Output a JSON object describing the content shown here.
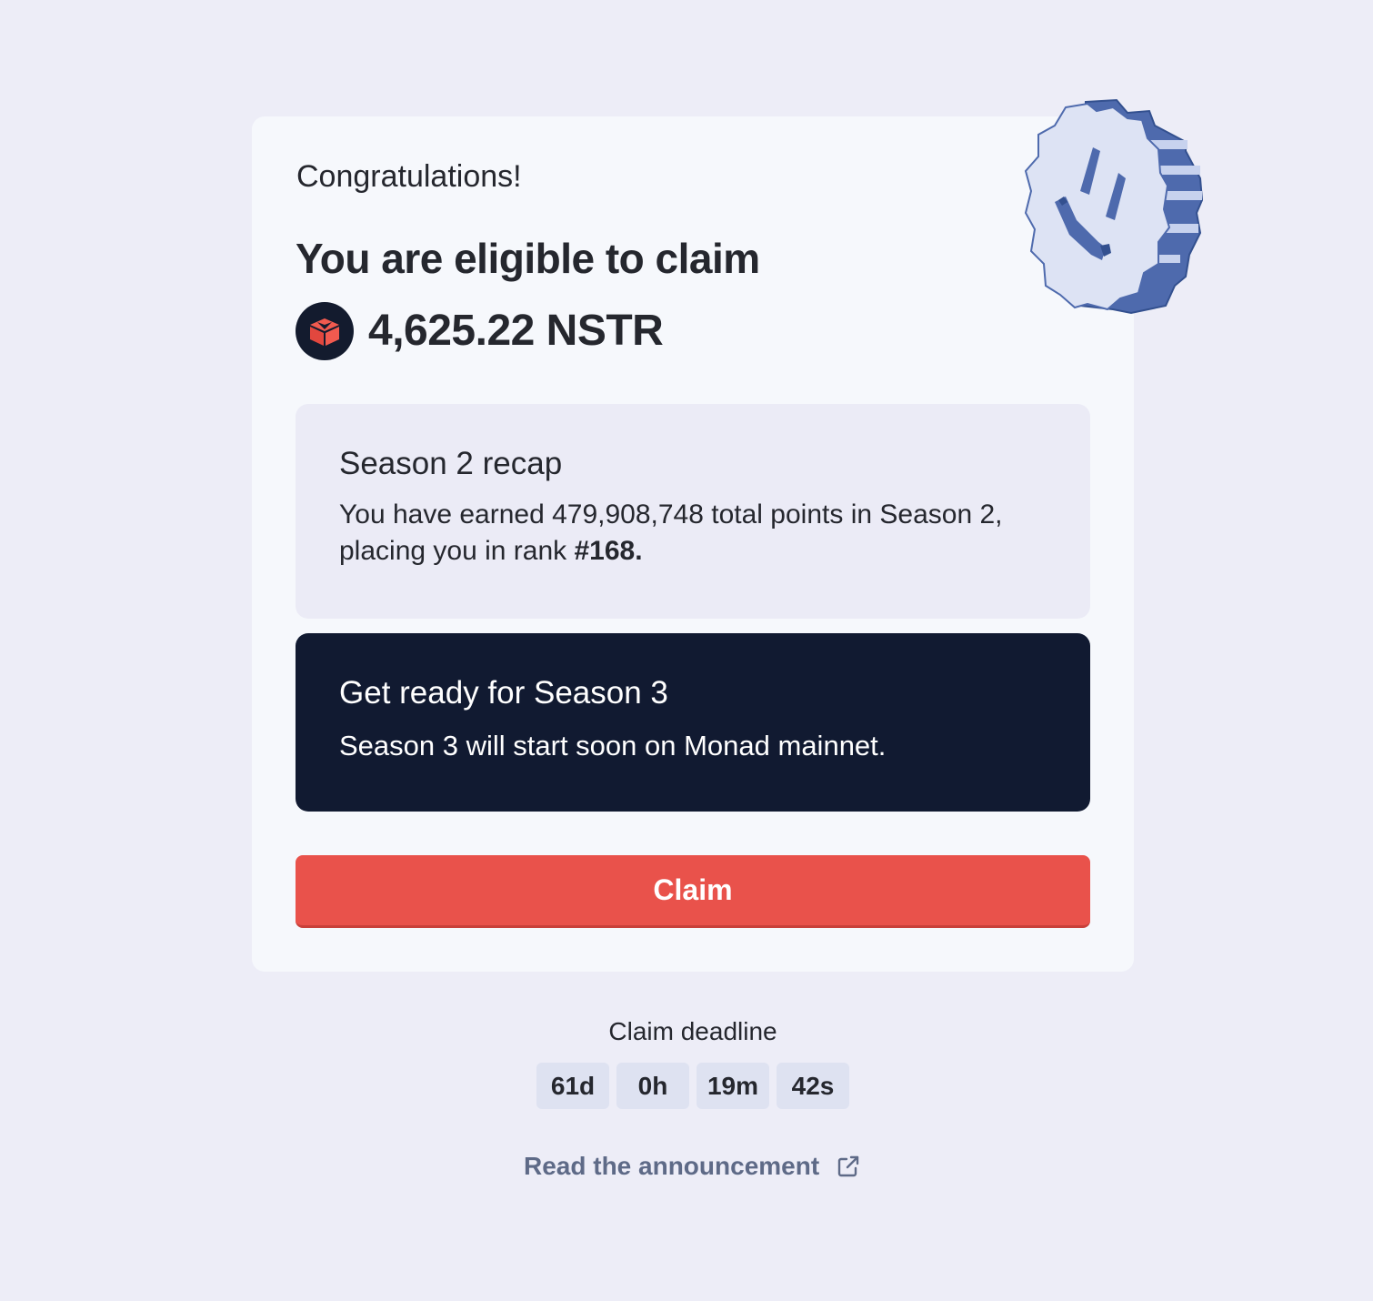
{
  "card": {
    "greeting": "Congratulations!",
    "headline": "You are eligible to claim",
    "amount": "4,625.22 NSTR",
    "token_icon": "nstr-token-icon",
    "mascot_icon": "smiley-coin-icon"
  },
  "recap": {
    "title": "Season 2 recap",
    "body_prefix": "You have earned 479,908,748 total points in Season 2, placing you in rank ",
    "rank": "#168."
  },
  "season3": {
    "title": "Get ready for Season 3",
    "body": "Season 3 will start soon on Monad mainnet."
  },
  "claim_button": {
    "label": "Claim"
  },
  "deadline": {
    "label": "Claim deadline",
    "days": "61d",
    "hours": "0h",
    "minutes": "19m",
    "seconds": "42s"
  },
  "announcement": {
    "label": "Read the announcement",
    "icon": "external-link-icon"
  },
  "colors": {
    "page_bg": "#ededf7",
    "card_bg": "#f6f8fc",
    "recap_bg": "#ebebf6",
    "season3_bg": "#111a31",
    "claim_red": "#e9524b",
    "countdown_bg": "#dee2f1",
    "link_gray": "#5e6a87"
  }
}
